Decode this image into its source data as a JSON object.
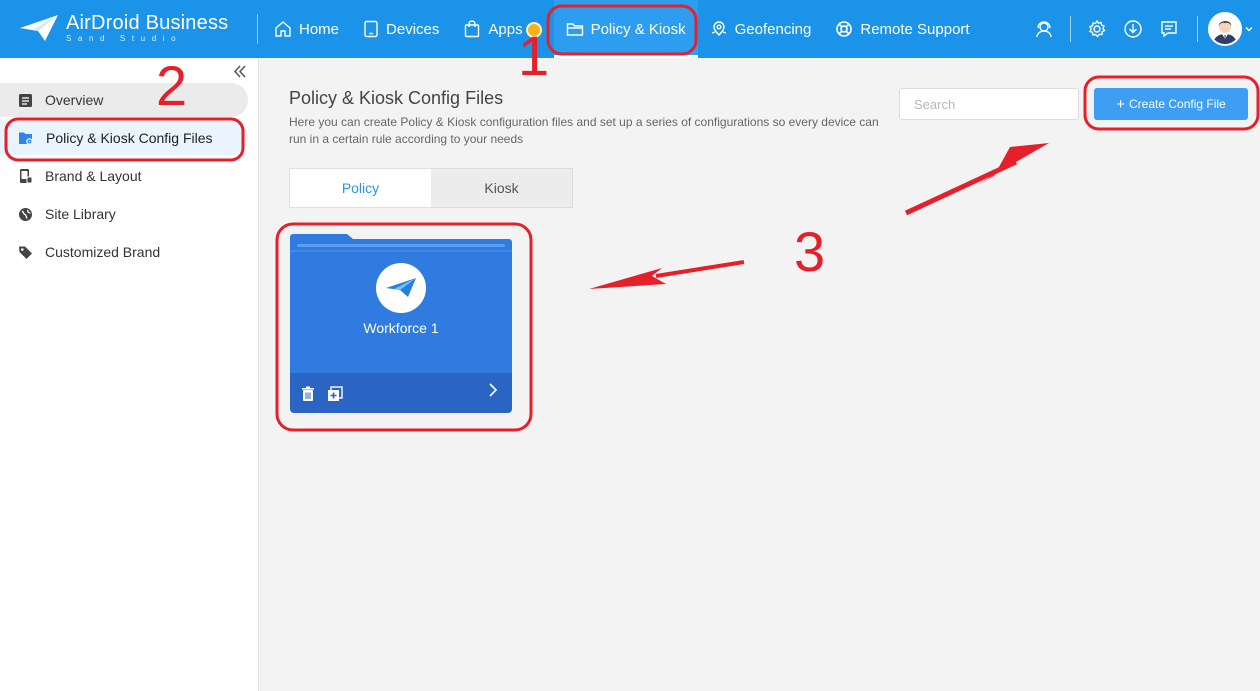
{
  "app": {
    "brand_name": "AirDroid Business",
    "brand_sub": "Sand Studio"
  },
  "nav": {
    "items": [
      {
        "label": "Home",
        "icon": "home-icon"
      },
      {
        "label": "Devices",
        "icon": "device-icon"
      },
      {
        "label": "Apps",
        "icon": "bag-icon"
      },
      {
        "label": "Policy & Kiosk",
        "icon": "folder-icon",
        "active": true
      },
      {
        "label": "Geofencing",
        "icon": "map-pin-icon"
      },
      {
        "label": "Remote Support",
        "icon": "lifebuoy-icon"
      }
    ]
  },
  "topbar_icons": [
    "headset-icon",
    "gear-icon",
    "download-icon",
    "message-icon",
    "avatar"
  ],
  "sidebar": {
    "items": [
      {
        "label": "Overview",
        "icon": "document-icon"
      },
      {
        "label": "Policy & Kiosk Config Files",
        "icon": "folder-config-icon",
        "active": true
      },
      {
        "label": "Brand & Layout",
        "icon": "phone-layout-icon"
      },
      {
        "label": "Site Library",
        "icon": "globe-icon"
      },
      {
        "label": "Customized Brand",
        "icon": "tag-icon"
      }
    ]
  },
  "main": {
    "title": "Policy & Kiosk Config Files",
    "description": "Here you can create Policy & Kiosk configuration files and set up a series of configurations so every device can run in a certain rule according to your needs",
    "search_placeholder": "Search",
    "create_button": "Create Config File",
    "tabs": [
      {
        "label": "Policy",
        "active": true
      },
      {
        "label": "Kiosk",
        "active": false
      }
    ],
    "cards": [
      {
        "name": "Workforce 1"
      }
    ]
  },
  "annotations": {
    "step1": "1",
    "step2": "2",
    "step3": "3"
  },
  "colors": {
    "topbar": "#1b93e8",
    "accent": "#3e9ef3",
    "card": "#2f7be0",
    "annotation": "#e5202a"
  }
}
